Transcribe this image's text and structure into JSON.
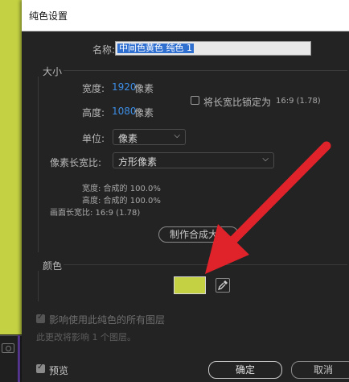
{
  "dialog": {
    "title": "纯色设置"
  },
  "name": {
    "label": "名称:",
    "value": "中间色黄色 纯色 1"
  },
  "size": {
    "group_label": "大小",
    "width_label": "宽度:",
    "width_value": "1920",
    "width_unit": "像素",
    "height_label": "高度:",
    "height_value": "1080",
    "height_unit": "像素",
    "lock_ratio_label": "将长宽比锁定为",
    "lock_ratio_value": "16:9 (1.78)",
    "unit_label": "单位:",
    "unit_value": "像素",
    "pixel_aspect_label": "像素长宽比:",
    "pixel_aspect_value": "方形像素",
    "comp_width": "宽度: 合成的 100.0%",
    "comp_height": "高度: 合成的 100.0%",
    "frame_aspect": "画面长宽比: 16:9 (1.78)",
    "make_comp_size_button": "制作合成大小"
  },
  "color": {
    "group_label": "颜色",
    "swatch_color": "#c3d142"
  },
  "affect": {
    "checkbox_label": "影响使用此纯色的所有图层",
    "note": "此更改将影响 1 个图层。"
  },
  "footer": {
    "preview_label": "预览",
    "ok_button": "确定",
    "cancel_button": "取消"
  },
  "annotation": {
    "arrow_color": "#e0232a"
  }
}
